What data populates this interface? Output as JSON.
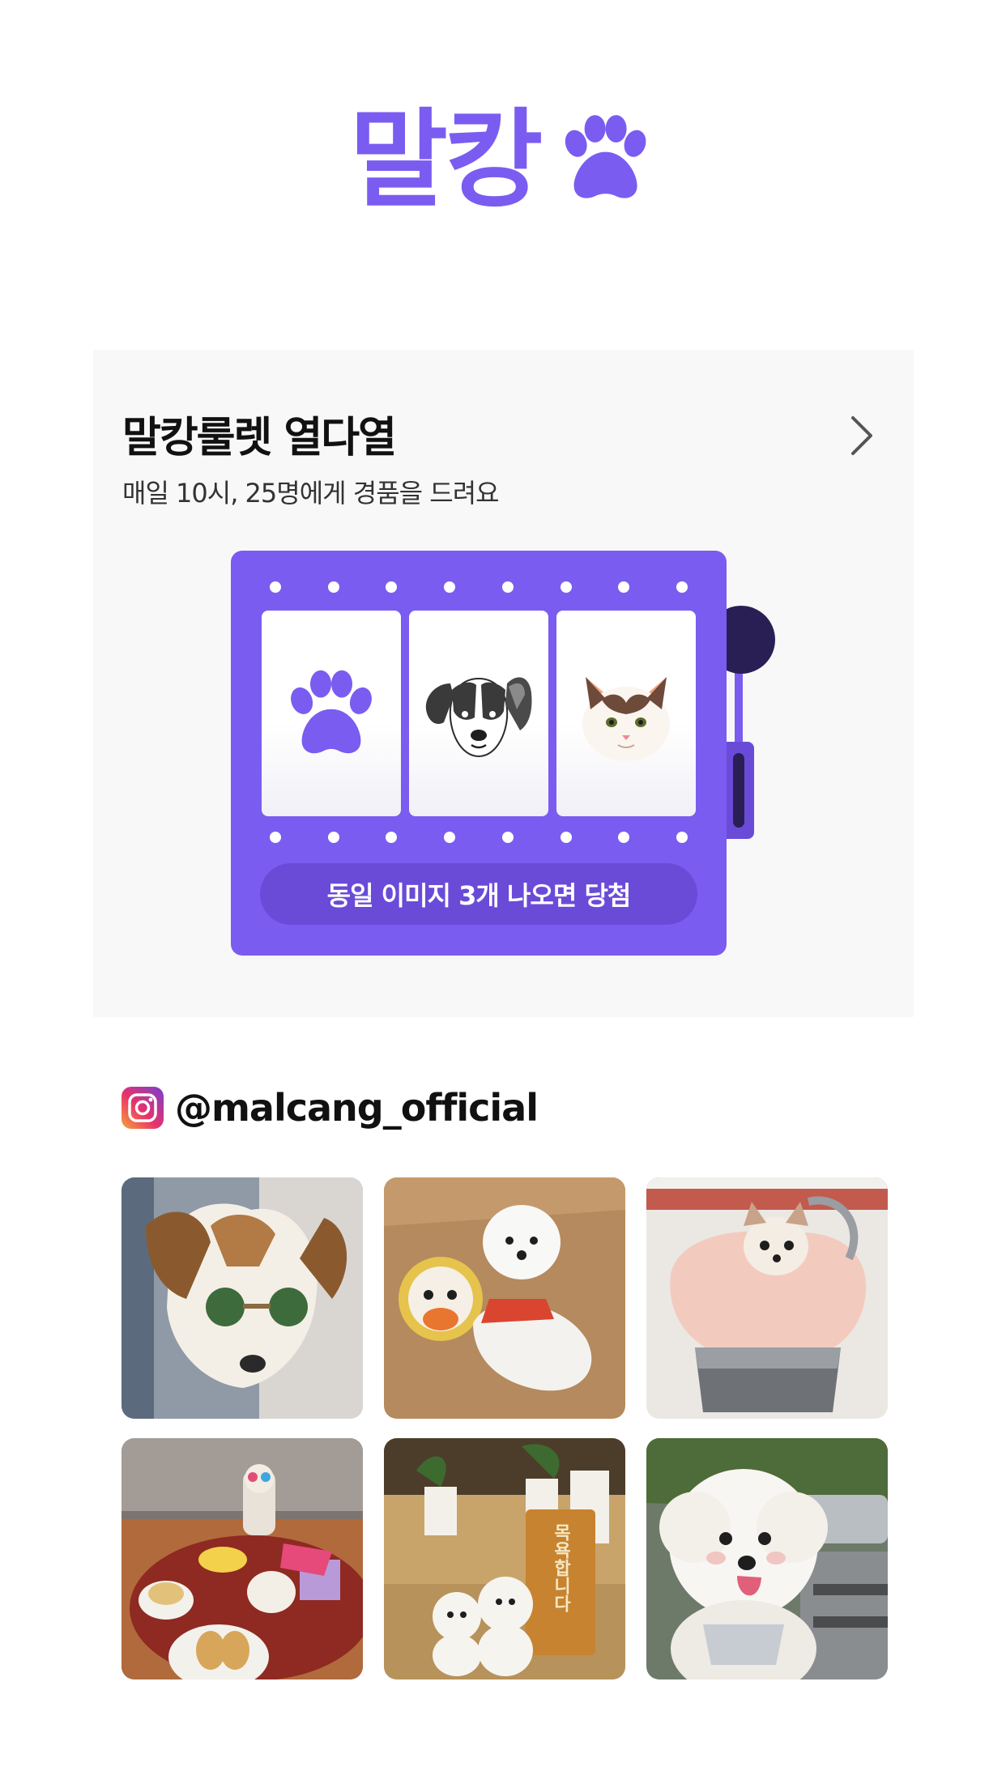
{
  "logo": {
    "text": "말캉",
    "icon": "paw-icon",
    "color": "#7b5cf0"
  },
  "roulette": {
    "title": "말캉룰렛 열다열",
    "subtitle": "매일 10시, 25명에게 경품을 드려요",
    "chevron_icon": "chevron-right-icon",
    "reels": [
      "paw-icon",
      "dog-icon",
      "cat-icon"
    ],
    "caption": "동일 이미지 3개 나오면 당첨",
    "machine_color": "#7b5cf0",
    "lever_color": "#2a1f55",
    "background": "#f8f8f8"
  },
  "instagram": {
    "icon": "instagram-icon",
    "handle": "@malcang_official",
    "photos": [
      "dog-with-sunglasses-photo",
      "puppy-with-plush-toy-photo",
      "dog-in-pink-bag-photo",
      "birthday-table-photo",
      "two-poodles-shop-sign-photo",
      "fluffy-poodle-photo"
    ],
    "photo_sign_text": "목욕합니다"
  }
}
